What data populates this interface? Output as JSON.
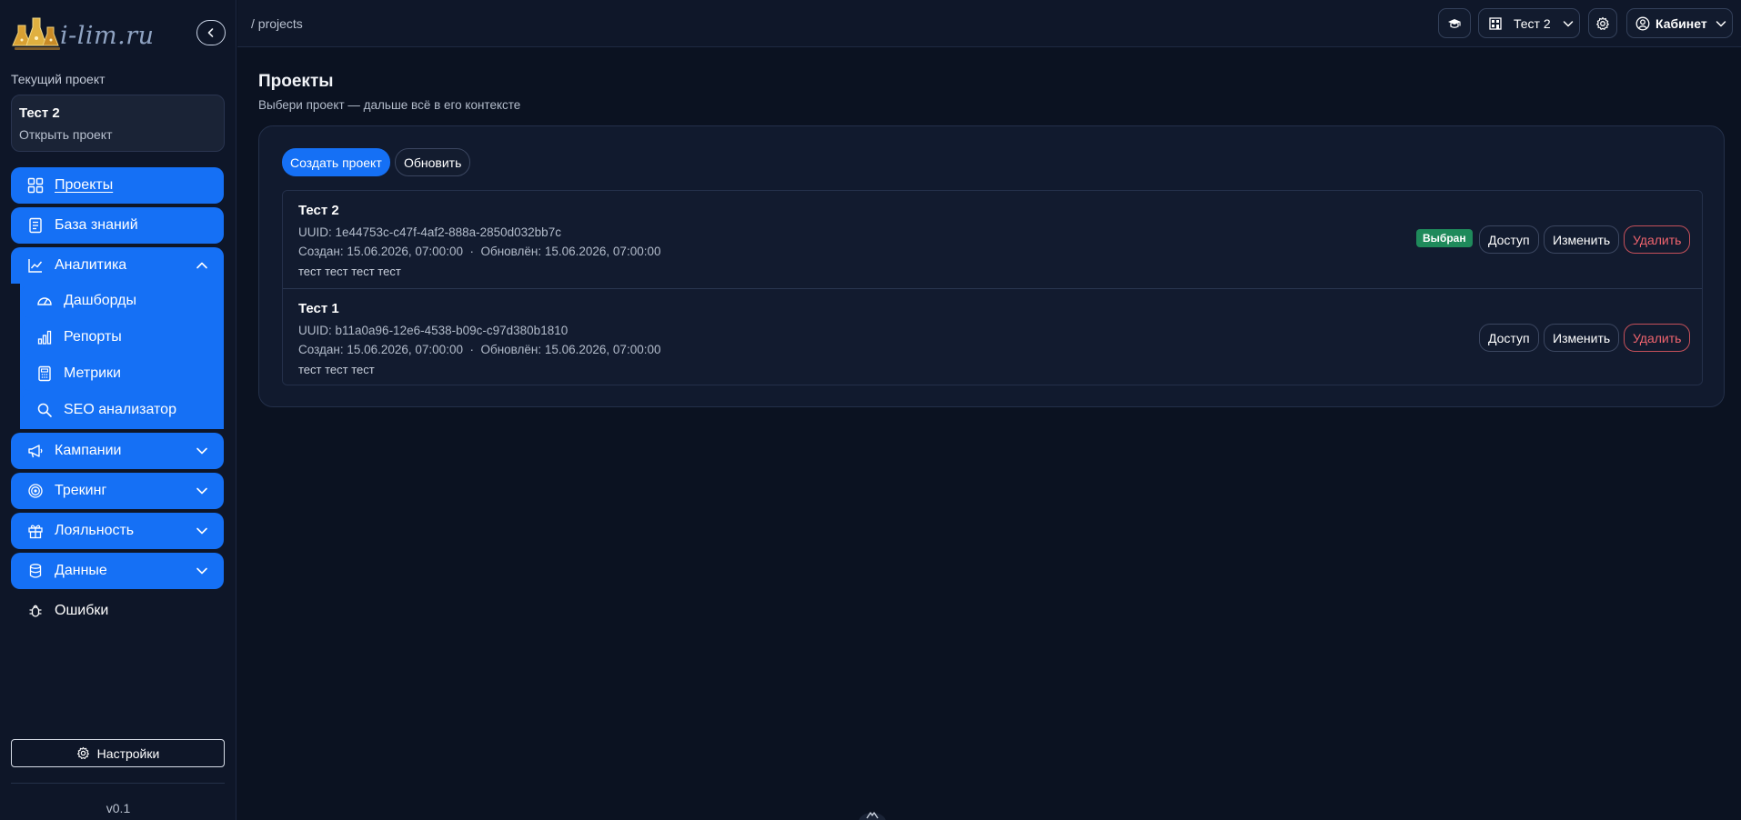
{
  "brand": {
    "logo_text": "i-lim.ru",
    "version": "v0.1"
  },
  "sidebar": {
    "current_project_label": "Текущий проект",
    "current_project_name": "Тест 2",
    "current_project_action": "Открыть проект",
    "items": [
      {
        "label": "Проекты",
        "icon": "grid-icon",
        "active": true
      },
      {
        "label": "База знаний",
        "icon": "book-icon"
      },
      {
        "label": "Аналитика",
        "icon": "chart-line-icon",
        "expanded": true,
        "children": [
          {
            "label": "Дашборды",
            "icon": "gauge-icon"
          },
          {
            "label": "Репорты",
            "icon": "bar-chart-icon"
          },
          {
            "label": "Метрики",
            "icon": "calculator-icon"
          },
          {
            "label": "SEO анализатор",
            "icon": "search-icon"
          }
        ]
      },
      {
        "label": "Кампании",
        "icon": "megaphone-icon"
      },
      {
        "label": "Трекинг",
        "icon": "target-icon"
      },
      {
        "label": "Лояльность",
        "icon": "gift-icon"
      },
      {
        "label": "Данные",
        "icon": "database-icon"
      },
      {
        "label": "Ошибки",
        "icon": "bug-icon"
      }
    ],
    "settings_label": "Настройки"
  },
  "topbar": {
    "breadcrumb": "/ projects",
    "project_selector": "Тест 2",
    "cabinet_label": "Кабинет"
  },
  "main": {
    "title": "Проекты",
    "subtitle": "Выбери проект — дальше всё в его контексте",
    "create_label": "Создать проект",
    "refresh_label": "Обновить",
    "projects": [
      {
        "name": "Тест 2",
        "uuid": "UUID: 1e44753c-c47f-4af2-888a-2850d032bb7c",
        "dates": "Создан: 15.06.2026, 07:00:00  ·  Обновлён: 15.06.2026, 07:00:00",
        "description": "тест тест тест тест",
        "selected_badge": "Выбран"
      },
      {
        "name": "Тест 1",
        "uuid": "UUID: b11a0a96-12e6-4538-b09c-c97d380b1810",
        "dates": "Создан: 15.06.2026, 07:00:00  ·  Обновлён: 15.06.2026, 07:00:00",
        "description": "тест тест тест"
      }
    ],
    "row_actions": {
      "access": "Доступ",
      "edit": "Изменить",
      "delete": "Удалить"
    }
  },
  "colors": {
    "accent": "#1570f5",
    "background": "#0b1221",
    "danger": "#f0646e",
    "success": "#1f8a5b"
  }
}
